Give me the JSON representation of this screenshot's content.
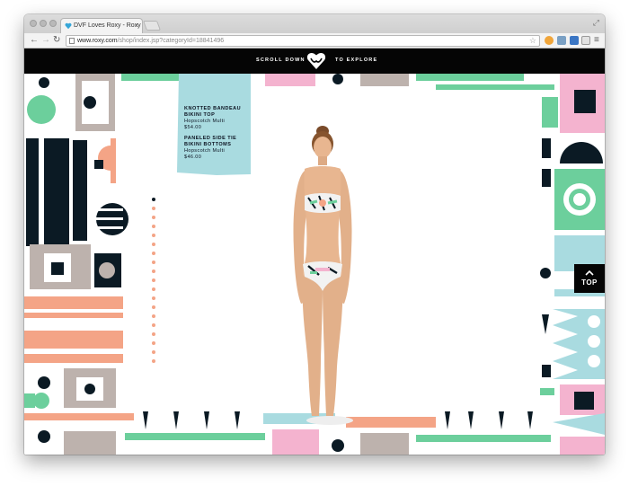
{
  "browser": {
    "tab_title": "DVF Loves Roxy - Roxy",
    "tab_close": "×",
    "url_domain": "www.roxy.com",
    "url_path": "/shop/index.jsp?categoryId=18841496",
    "back_glyph": "←",
    "forward_glyph": "→",
    "reload_glyph": "↻",
    "star_glyph": "☆",
    "menu_glyph": "≡",
    "fullscreen_glyph": "⤢"
  },
  "page": {
    "scroll_prompt_left": "SCROLL DOWN",
    "scroll_prompt_right": "TO EXPLORE",
    "top_button_label": "TOP",
    "products": [
      {
        "name_line1": "KNOTTED BANDEAU",
        "name_line2": "BIKINI TOP",
        "color": "Hopscotch Multi",
        "price": "$54.00"
      },
      {
        "name_line1": "PANELED SIDE TIE",
        "name_line2": "BIKINI BOTTOMS",
        "color": "Hopscotch Multi",
        "price": "$46.00"
      }
    ]
  },
  "colors": {
    "navy": "#0b1a24",
    "mint": "#6ccf9c",
    "coral": "#f4a486",
    "pink": "#f4b3cf",
    "taupe": "#bdb2ad",
    "sky": "#a9dbe0",
    "black": "#050505"
  },
  "icons": {
    "logo": "roxy-heart-logo",
    "favicon": "roxy-heart-favicon",
    "star": "bookmark-star-icon",
    "menu": "menu-icon"
  }
}
